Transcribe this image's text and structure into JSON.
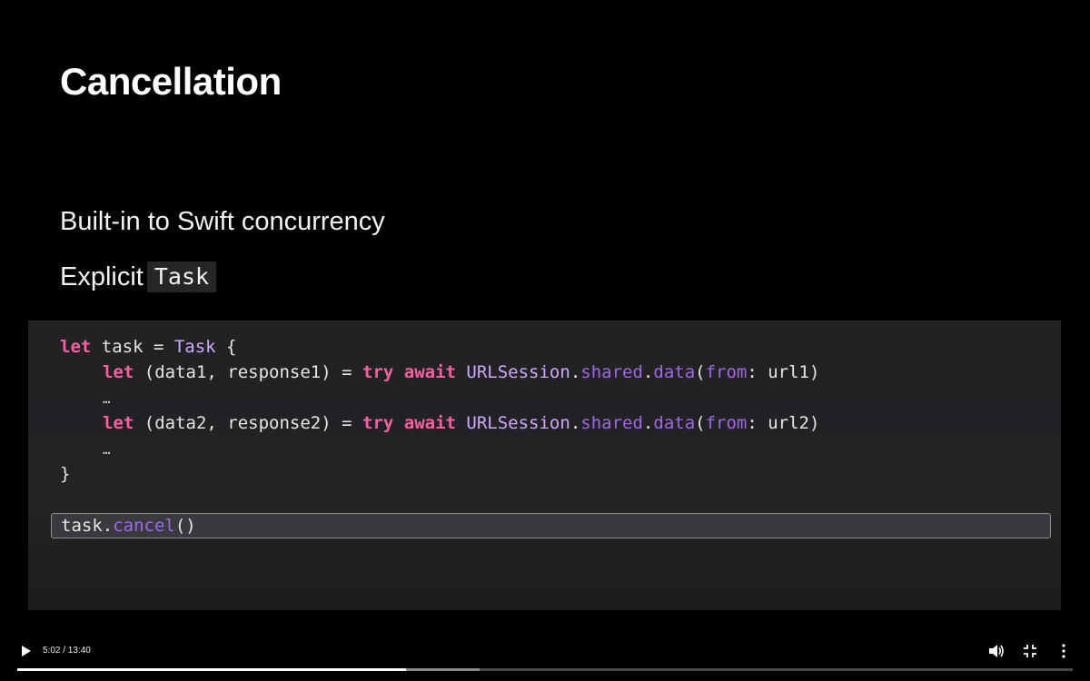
{
  "slide": {
    "title": "Cancellation",
    "bullets": [
      {
        "text": "Built-in to Swift concurrency"
      },
      {
        "text": "Explicit",
        "code": "Task"
      }
    ],
    "code": {
      "line1": {
        "kw": "let",
        "plain1": " task = ",
        "type": "Task",
        "plain2": " {"
      },
      "line2": {
        "kw1": "let",
        "plain1": " (data1, response1) = ",
        "kw2": "try",
        "kw3": "await",
        "type": " URLSession",
        "dot1": ".",
        "fn1": "shared",
        "dot2": ".",
        "fn2": "data",
        "paren": "(",
        "fn3": "from",
        "rest": ": url1)"
      },
      "line3": "…",
      "line4": {
        "kw1": "let",
        "plain1": " (data2, response2) = ",
        "kw2": "try",
        "kw3": "await",
        "type": " URLSession",
        "dot1": ".",
        "fn1": "shared",
        "dot2": ".",
        "fn2": "data",
        "paren": "(",
        "fn3": "from",
        "rest": ": url2)"
      },
      "line5": "…",
      "line6": "}",
      "highlight": {
        "obj": "task",
        "dot": ".",
        "fn": "cancel",
        "rest": "()"
      }
    }
  },
  "player": {
    "time": "5:02 / 13:40",
    "progress_fraction": 0.368,
    "buffered_fraction": 0.438,
    "icons": {
      "play": "play-icon",
      "volume": "volume-icon",
      "exit_fullscreen": "exit-fullscreen-icon",
      "more": "more-vertical-icon"
    }
  }
}
